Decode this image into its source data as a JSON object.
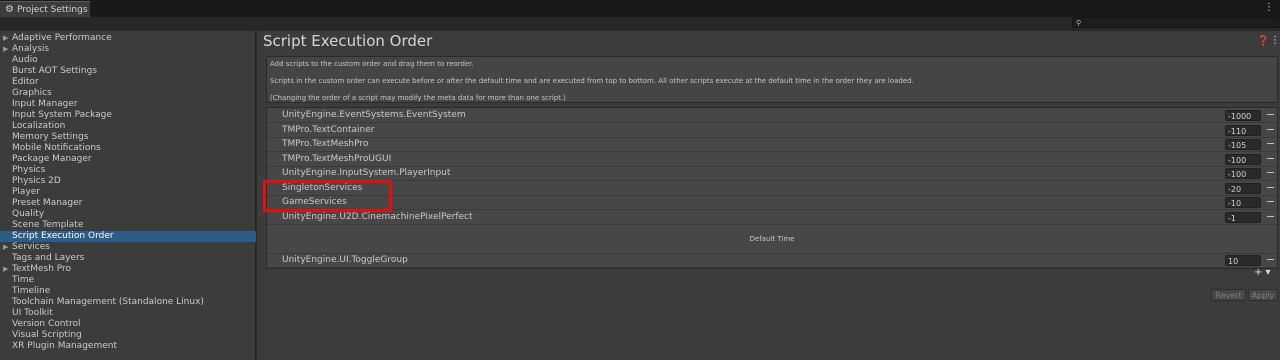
{
  "window": {
    "tab_title": "Project Settings",
    "tab_icon": "gear-icon"
  },
  "search": {
    "placeholder": ""
  },
  "sidebar": {
    "selected": "Script Execution Order",
    "items": [
      {
        "label": "Adaptive Performance",
        "expandable": true
      },
      {
        "label": "Analysis",
        "expandable": true
      },
      {
        "label": "Audio",
        "expandable": false
      },
      {
        "label": "Burst AOT Settings",
        "expandable": false
      },
      {
        "label": "Editor",
        "expandable": false
      },
      {
        "label": "Graphics",
        "expandable": false
      },
      {
        "label": "Input Manager",
        "expandable": false
      },
      {
        "label": "Input System Package",
        "expandable": false
      },
      {
        "label": "Localization",
        "expandable": false
      },
      {
        "label": "Memory Settings",
        "expandable": false
      },
      {
        "label": "Mobile Notifications",
        "expandable": false
      },
      {
        "label": "Package Manager",
        "expandable": false
      },
      {
        "label": "Physics",
        "expandable": false
      },
      {
        "label": "Physics 2D",
        "expandable": false
      },
      {
        "label": "Player",
        "expandable": false
      },
      {
        "label": "Preset Manager",
        "expandable": false
      },
      {
        "label": "Quality",
        "expandable": false
      },
      {
        "label": "Scene Template",
        "expandable": false
      },
      {
        "label": "Script Execution Order",
        "expandable": false
      },
      {
        "label": "Services",
        "expandable": true
      },
      {
        "label": "Tags and Layers",
        "expandable": false
      },
      {
        "label": "TextMesh Pro",
        "expandable": true
      },
      {
        "label": "Time",
        "expandable": false
      },
      {
        "label": "Timeline",
        "expandable": false
      },
      {
        "label": "Toolchain Management (Standalone Linux)",
        "expandable": false
      },
      {
        "label": "UI Toolkit",
        "expandable": false
      },
      {
        "label": "Version Control",
        "expandable": false
      },
      {
        "label": "Visual Scripting",
        "expandable": false
      },
      {
        "label": "XR Plugin Management",
        "expandable": false
      }
    ]
  },
  "main": {
    "title": "Script Execution Order",
    "info": [
      "Add scripts to the custom order and drag them to reorder.",
      "Scripts in the custom order can execute before or after the default time and are executed from top to bottom. All other scripts execute at the default time in the order they are loaded.",
      "(Changing the order of a script may modify the meta data for more than one script.)"
    ],
    "before_default": [
      {
        "name": "UnityEngine.EventSystems.EventSystem",
        "order": "-1000"
      },
      {
        "name": "TMPro.TextContainer",
        "order": "-110"
      },
      {
        "name": "TMPro.TextMeshPro",
        "order": "-105"
      },
      {
        "name": "TMPro.TextMeshProUGUI",
        "order": "-100"
      },
      {
        "name": "UnityEngine.InputSystem.PlayerInput",
        "order": "-100"
      },
      {
        "name": "SingletonServices",
        "order": "-20"
      },
      {
        "name": "GameServices",
        "order": "-10"
      },
      {
        "name": "UnityEngine.U2D.CinemachinePixelPerfect",
        "order": "-1"
      }
    ],
    "default_time_label": "Default Time",
    "after_default": [
      {
        "name": "UnityEngine.UI.ToggleGroup",
        "order": "10"
      }
    ],
    "revert_label": "Revert",
    "apply_label": "Apply",
    "annotation_color": "#e01010"
  }
}
